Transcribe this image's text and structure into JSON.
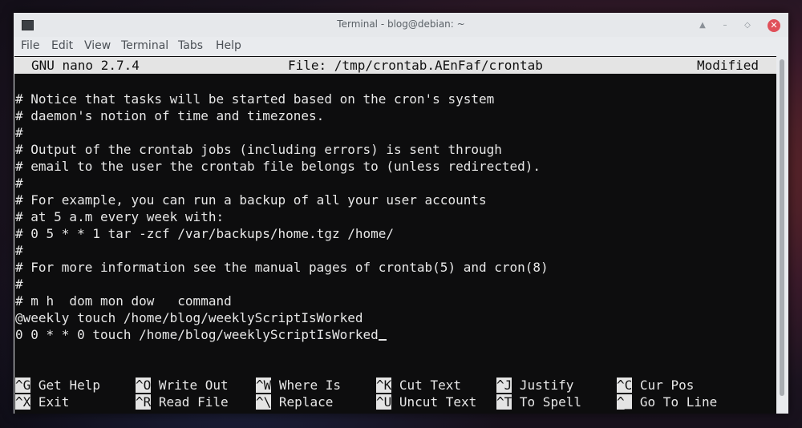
{
  "window": {
    "title": "Terminal - blog@debian: ~",
    "controls": {
      "shade": "▲",
      "minimize": "–",
      "maximize": "◇",
      "close": "✕"
    }
  },
  "menubar": {
    "items": [
      "File",
      "Edit",
      "View",
      "Terminal",
      "Tabs",
      "Help"
    ]
  },
  "nano": {
    "version_label": "GNU nano 2.7.4",
    "file_label": "File: /tmp/crontab.AEnFaf/crontab",
    "status": "Modified",
    "lines": [
      "",
      "# Notice that tasks will be started based on the cron's system",
      "# daemon's notion of time and timezones.",
      "#",
      "# Output of the crontab jobs (including errors) is sent through",
      "# email to the user the crontab file belongs to (unless redirected).",
      "#",
      "# For example, you can run a backup of all your user accounts",
      "# at 5 a.m every week with:",
      "# 0 5 * * 1 tar -zcf /var/backups/home.tgz /home/",
      "#",
      "# For more information see the manual pages of crontab(5) and cron(8)",
      "#",
      "# m h  dom mon dow   command",
      "@weekly touch /home/blog/weeklyScriptIsWorked",
      "0 0 * * 0 touch /home/blog/weeklyScriptIsWorked"
    ],
    "shortcuts_row1": [
      {
        "key": "^G",
        "label": "Get Help"
      },
      {
        "key": "^O",
        "label": "Write Out"
      },
      {
        "key": "^W",
        "label": "Where Is"
      },
      {
        "key": "^K",
        "label": "Cut Text"
      },
      {
        "key": "^J",
        "label": "Justify"
      },
      {
        "key": "^C",
        "label": "Cur Pos"
      }
    ],
    "shortcuts_row2": [
      {
        "key": "^X",
        "label": "Exit"
      },
      {
        "key": "^R",
        "label": "Read File"
      },
      {
        "key": "^\\",
        "label": "Replace"
      },
      {
        "key": "^U",
        "label": "Uncut Text"
      },
      {
        "key": "^T",
        "label": "To Spell"
      },
      {
        "key": "^_",
        "label": "Go To Line"
      }
    ]
  },
  "colors": {
    "terminal_bg": "#0d0d0e",
    "terminal_fg": "#e7e7e7",
    "close_button": "#e0505a"
  }
}
